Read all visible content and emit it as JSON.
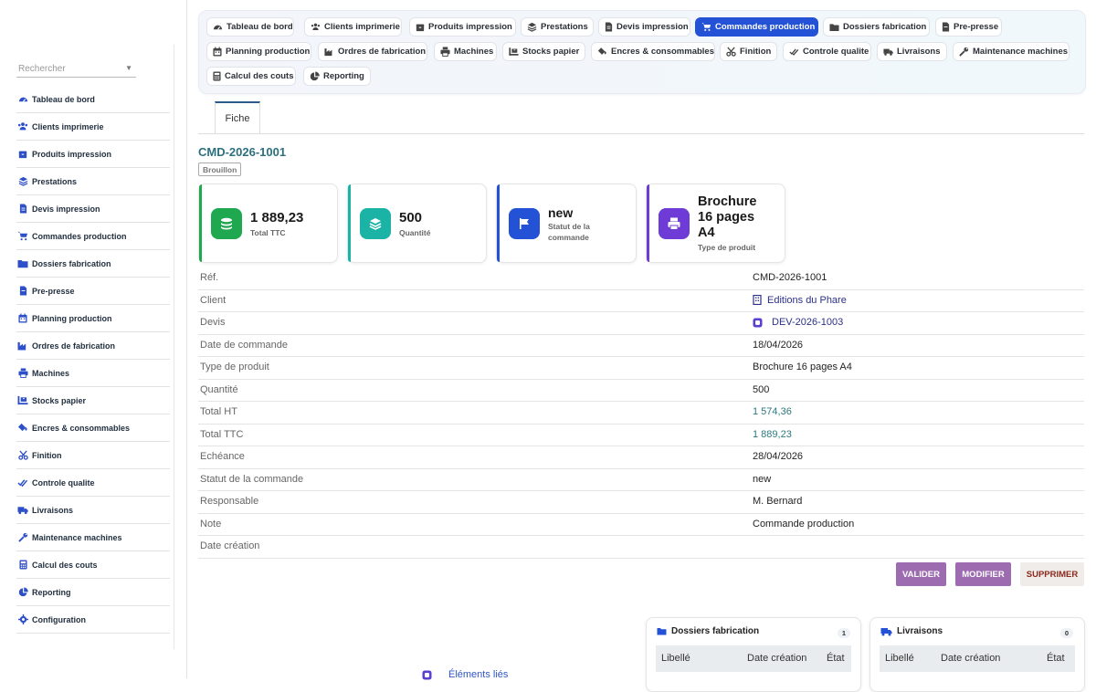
{
  "colors": {
    "accent": "#2452d6",
    "success": "#1fa84f",
    "teal": "#1ab3a6",
    "violet": "#6f3bd6",
    "action": "#9d6cb0"
  },
  "search": {
    "placeholder": "Rechercher"
  },
  "sidebar": {
    "items": [
      {
        "label": "Tableau de bord",
        "icon": "gauge-icon"
      },
      {
        "label": "Clients imprimerie",
        "icon": "users-icon"
      },
      {
        "label": "Produits impression",
        "icon": "box-icon"
      },
      {
        "label": "Prestations",
        "icon": "layers-icon"
      },
      {
        "label": "Devis impression",
        "icon": "document-icon"
      },
      {
        "label": "Commandes production",
        "icon": "cart-icon"
      },
      {
        "label": "Dossiers fabrication",
        "icon": "folder-icon"
      },
      {
        "label": "Pre-presse",
        "icon": "file-icon"
      },
      {
        "label": "Planning production",
        "icon": "calendar-icon"
      },
      {
        "label": "Ordres de fabrication",
        "icon": "industry-icon"
      },
      {
        "label": "Machines",
        "icon": "printer-icon"
      },
      {
        "label": "Stocks papier",
        "icon": "pallet-icon"
      },
      {
        "label": "Encres & consommables",
        "icon": "fill-drip-icon"
      },
      {
        "label": "Finition",
        "icon": "scissors-icon"
      },
      {
        "label": "Controle qualite",
        "icon": "check-double-icon"
      },
      {
        "label": "Livraisons",
        "icon": "truck-icon"
      },
      {
        "label": "Maintenance machines",
        "icon": "wrench-icon"
      },
      {
        "label": "Calcul des couts",
        "icon": "calculator-icon"
      },
      {
        "label": "Reporting",
        "icon": "pie-chart-icon"
      },
      {
        "label": "Configuration",
        "icon": "gear-icon"
      }
    ]
  },
  "tabs": [
    {
      "label": "Tableau de bord",
      "icon": "gauge-icon"
    },
    {
      "label": "Clients imprimerie",
      "icon": "users-icon"
    },
    {
      "label": "Produits impression",
      "icon": "box-icon"
    },
    {
      "label": "Prestations",
      "icon": "layers-icon"
    },
    {
      "label": "Devis impression",
      "icon": "document-icon"
    },
    {
      "label": "Commandes production",
      "icon": "cart-icon",
      "active": true
    },
    {
      "label": "Dossiers fabrication",
      "icon": "folder-icon"
    },
    {
      "label": "Pre-presse",
      "icon": "file-icon"
    },
    {
      "label": "Planning production",
      "icon": "calendar-icon"
    },
    {
      "label": "Ordres de fabrication",
      "icon": "industry-icon"
    },
    {
      "label": "Machines",
      "icon": "printer-icon"
    },
    {
      "label": "Stocks papier",
      "icon": "pallet-icon"
    },
    {
      "label": "Encres & consommables",
      "icon": "fill-drip-icon"
    },
    {
      "label": "Finition",
      "icon": "scissors-icon"
    },
    {
      "label": "Controle qualite",
      "icon": "check-double-icon"
    },
    {
      "label": "Livraisons",
      "icon": "truck-icon"
    },
    {
      "label": "Maintenance machines",
      "icon": "wrench-icon"
    },
    {
      "label": "Calcul des couts",
      "icon": "calculator-icon"
    },
    {
      "label": "Reporting",
      "icon": "pie-chart-icon"
    }
  ],
  "record": {
    "tab_label": "Fiche",
    "ref": "CMD-2026-1001",
    "status_badge": "Brouillon"
  },
  "cards": [
    {
      "value": "1 889,23",
      "label": "Total TTC",
      "icon": "coins-icon"
    },
    {
      "value": "500",
      "label": "Quantité",
      "icon": "layers-icon"
    },
    {
      "value": "new",
      "label": "Statut de la commande",
      "icon": "flag-icon"
    },
    {
      "value": "Brochure 16 pages A4",
      "label": "Type de produit",
      "icon": "printer-icon"
    }
  ],
  "fields": [
    {
      "key": "Réf.",
      "value": "CMD-2026-1001"
    },
    {
      "key": "Client",
      "value": "Editions du Phare",
      "icon": "building-icon"
    },
    {
      "key": "Devis",
      "value": "DEV-2026-1003",
      "icon": "quote-icon"
    },
    {
      "key": "Date de commande",
      "value": "18/04/2026"
    },
    {
      "key": "Type de produit",
      "value": "Brochure 16 pages A4"
    },
    {
      "key": "Quantité",
      "value": "500"
    },
    {
      "key": "Total HT",
      "value": "1 574,36"
    },
    {
      "key": "Total TTC",
      "value": "1 889,23"
    },
    {
      "key": "Echéance",
      "value": "28/04/2026"
    },
    {
      "key": "Statut de la commande",
      "value": "new"
    },
    {
      "key": "Responsable",
      "value": "M. Bernard"
    },
    {
      "key": "Note",
      "value": "Commande production"
    },
    {
      "key": "Date création",
      "value": ""
    }
  ],
  "actions": {
    "validate": "VALIDER",
    "modify": "MODIFIER",
    "delete": "SUPPRIMER"
  },
  "panels": {
    "dossiers": {
      "title": "Dossiers fabrication",
      "count": "1",
      "columns": [
        "Libellé",
        "Date création",
        "État"
      ]
    },
    "livraisons": {
      "title": "Livraisons",
      "count": "0",
      "columns": [
        "Libellé",
        "Date création",
        "État"
      ]
    }
  },
  "linked": {
    "label": "Éléments liés"
  }
}
